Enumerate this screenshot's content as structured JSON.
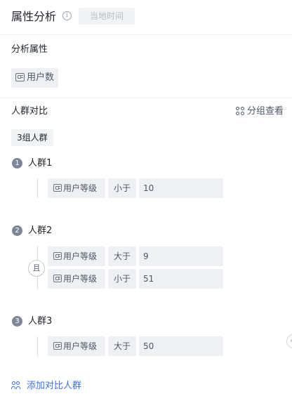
{
  "header": {
    "title": "属性分析",
    "info_icon": "info-icon",
    "time_label": "当地时间"
  },
  "analysis_attribute": {
    "label": "分析属性",
    "metric": "用户数"
  },
  "crowd_compare": {
    "label": "人群对比",
    "group_view_label": "分组查看",
    "group_count_label": "3组人群",
    "and_label": "且",
    "groups": [
      {
        "number": "1",
        "name": "人群1",
        "conditions": [
          {
            "field": "用户等级",
            "operator": "小于",
            "value": "10"
          }
        ]
      },
      {
        "number": "2",
        "name": "人群2",
        "conditions": [
          {
            "field": "用户等级",
            "operator": "大于",
            "value": "9"
          },
          {
            "field": "用户等级",
            "operator": "小于",
            "value": "51"
          }
        ]
      },
      {
        "number": "3",
        "name": "人群3",
        "conditions": [
          {
            "field": "用户等级",
            "operator": "大于",
            "value": "50"
          }
        ]
      }
    ]
  },
  "add_compare_label": "添加对比人群",
  "colors": {
    "accent": "#3b6fe8",
    "chip_bg": "#eef0f4",
    "badge": "#7d8699"
  }
}
